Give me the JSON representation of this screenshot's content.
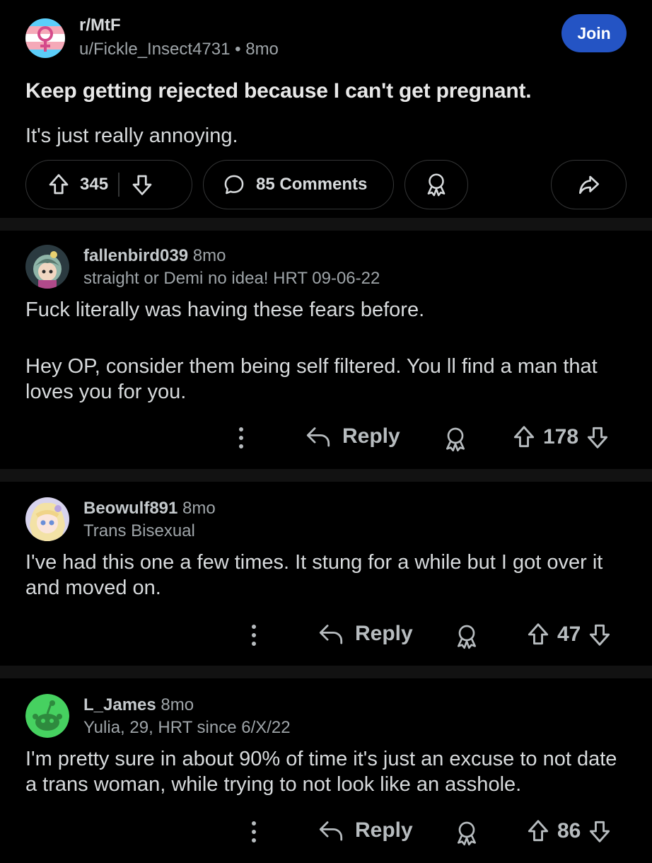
{
  "post": {
    "subreddit": "r/MtF",
    "author": "u/Fickle_Insect4731",
    "separator": "•",
    "age": "8mo",
    "join_label": "Join",
    "title": "Keep getting rejected because I can't get pregnant.",
    "body": "It's just really annoying.",
    "votes": "345",
    "comments_label": "85 Comments",
    "flag_colors": [
      "#5bcefa",
      "#f5a9b8",
      "#ffffff"
    ],
    "symbol_color": "#d44a8a"
  },
  "comments": [
    {
      "username": "fallenbird039",
      "age": "8mo",
      "flair": "straight or Demi no idea! HRT 09-06-22",
      "paragraphs": [
        "Fuck literally was having these fears before.",
        "Hey OP, consider them being self filtered.  You ll find a man that loves you for you."
      ],
      "reply_label": "Reply",
      "votes": "178"
    },
    {
      "username": "Beowulf891",
      "age": "8mo",
      "flair": "Trans Bisexual",
      "paragraphs": [
        "I've had this one a few times. It stung for a while but I got over it and moved on."
      ],
      "reply_label": "Reply",
      "votes": "47"
    },
    {
      "username": "L_James",
      "age": "8mo",
      "flair": "Yulia, 29, HRT since 6/X/22",
      "paragraphs": [
        "I'm pretty sure in about 90% of time it's just an excuse to not date a trans woman, while trying to not look like an asshole."
      ],
      "reply_label": "Reply",
      "votes": "86"
    }
  ],
  "icons": {
    "upvote": "arrow-up-icon",
    "downvote": "arrow-down-icon",
    "comment": "speech-bubble-icon",
    "award": "award-ribbon-icon",
    "share": "share-arrow-icon",
    "more": "vertical-dots-icon",
    "reply": "reply-arrow-icon"
  },
  "colors": {
    "background": "#000000",
    "separator": "#121212",
    "join_button": "#2454c4",
    "text_primary": "#d7dadc",
    "text_muted": "#9ea4a8"
  }
}
